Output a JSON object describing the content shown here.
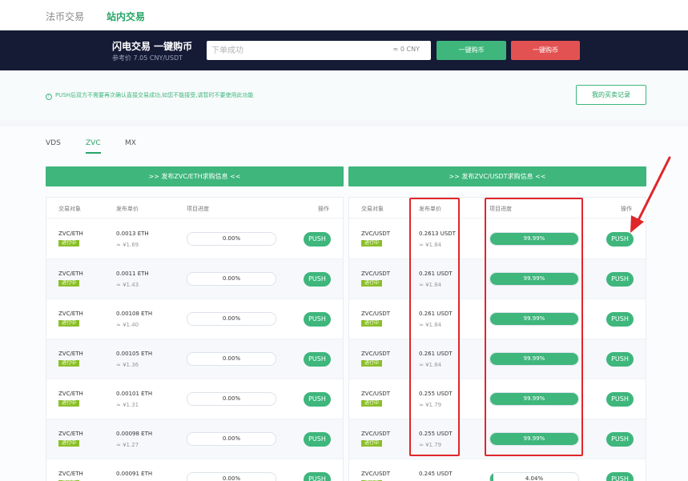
{
  "nav": {
    "tabs": [
      "法币交易",
      "站内交易"
    ],
    "active": "站内交易"
  },
  "flash": {
    "title": "闪电交易 一键购币",
    "ref_price": "参考价 7.05 CNY/USDT",
    "input_placeholder": "下单成功",
    "cny": "≈ 0 CNY",
    "buy_label": "一键购币",
    "sell_label": "一键购币"
  },
  "notice": {
    "message": "PUSH后双方不需要再次确认直接交易成功,如您不能接受,请暂时不要使用此功能",
    "record_button": "我的买卖记录"
  },
  "coins": [
    "VDS",
    "ZVC",
    "MX"
  ],
  "active_coin": "ZVC",
  "publish": {
    "eth": ">> 发布ZVC/ETH求购信息 <<",
    "usdt": ">> 发布ZVC/USDT求购信息 <<"
  },
  "table": {
    "headers": [
      "交易对象",
      "发布单价",
      "项目进度",
      "操作"
    ],
    "status": "进行中",
    "push_label": "PUSH",
    "eth_rows": [
      {
        "pair": "ZVC/ETH",
        "price": "0.0013 ETH",
        "cny": "≈ ¥1.69",
        "progress": "0.00%",
        "fill": 0
      },
      {
        "pair": "ZVC/ETH",
        "price": "0.0011 ETH",
        "cny": "≈ ¥1.43",
        "progress": "0.00%",
        "fill": 0
      },
      {
        "pair": "ZVC/ETH",
        "price": "0.00108 ETH",
        "cny": "≈ ¥1.40",
        "progress": "0.00%",
        "fill": 0
      },
      {
        "pair": "ZVC/ETH",
        "price": "0.00105 ETH",
        "cny": "≈ ¥1.36",
        "progress": "0.00%",
        "fill": 0
      },
      {
        "pair": "ZVC/ETH",
        "price": "0.00101 ETH",
        "cny": "≈ ¥1.31",
        "progress": "0.00%",
        "fill": 0
      },
      {
        "pair": "ZVC/ETH",
        "price": "0.00098 ETH",
        "cny": "≈ ¥1.27",
        "progress": "0.00%",
        "fill": 0
      },
      {
        "pair": "ZVC/ETH",
        "price": "0.00091 ETH",
        "cny": "",
        "progress": "0.00%",
        "fill": 0
      }
    ],
    "usdt_rows": [
      {
        "pair": "ZVC/USDT",
        "price": "0.2613 USDT",
        "cny": "≈ ¥1.84",
        "progress": "99.99%",
        "fill": 0.9999
      },
      {
        "pair": "ZVC/USDT",
        "price": "0.261 USDT",
        "cny": "≈ ¥1.84",
        "progress": "99.99%",
        "fill": 0.9999
      },
      {
        "pair": "ZVC/USDT",
        "price": "0.261 USDT",
        "cny": "≈ ¥1.84",
        "progress": "99.99%",
        "fill": 0.9999
      },
      {
        "pair": "ZVC/USDT",
        "price": "0.261 USDT",
        "cny": "≈ ¥1.84",
        "progress": "99.99%",
        "fill": 0.9999
      },
      {
        "pair": "ZVC/USDT",
        "price": "0.255 USDT",
        "cny": "≈ ¥1.79",
        "progress": "99.99%",
        "fill": 0.9999
      },
      {
        "pair": "ZVC/USDT",
        "price": "0.255 USDT",
        "cny": "≈ ¥1.79",
        "progress": "99.99%",
        "fill": 0.9999
      },
      {
        "pair": "ZVC/USDT",
        "price": "0.245 USDT",
        "cny": "",
        "progress": "4.04%",
        "fill": 0.0404
      }
    ]
  },
  "colors": {
    "green": "#3eb67c",
    "red": "#e35252",
    "badge": "#8bbf28",
    "navy": "#151a35"
  }
}
